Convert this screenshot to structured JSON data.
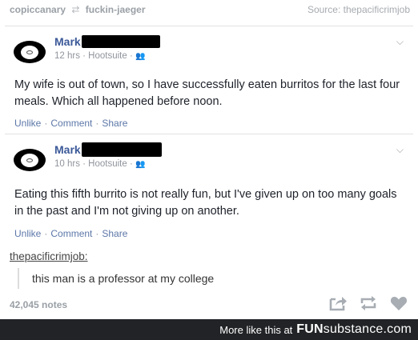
{
  "reblog": {
    "from": "copiccanary",
    "to": "fuckin-jaeger",
    "source": "Source: thepacificrimjob"
  },
  "posts": [
    {
      "name": "Mark",
      "meta": "12 hrs · Hootsuite ·",
      "text": "My wife is out of town, so I have successfully eaten burritos for the last four meals. Which all happened before noon.",
      "actions": [
        "Unlike",
        "Comment",
        "Share"
      ]
    },
    {
      "name": "Mark",
      "meta": "10 hrs · Hootsuite ·",
      "text": "Eating this fifth burrito is not really fun, but I've given up on too many goals in the past and I'm not giving up on another.",
      "actions": [
        "Unlike",
        "Comment",
        "Share"
      ]
    }
  ],
  "reply": {
    "user": "thepacificrimjob:",
    "quote": "this man is a professor at my college"
  },
  "notes": "42,045 notes",
  "footer": {
    "more_text": "More like this at",
    "brand_bold": "FUN",
    "brand_rest": "substance.com"
  }
}
